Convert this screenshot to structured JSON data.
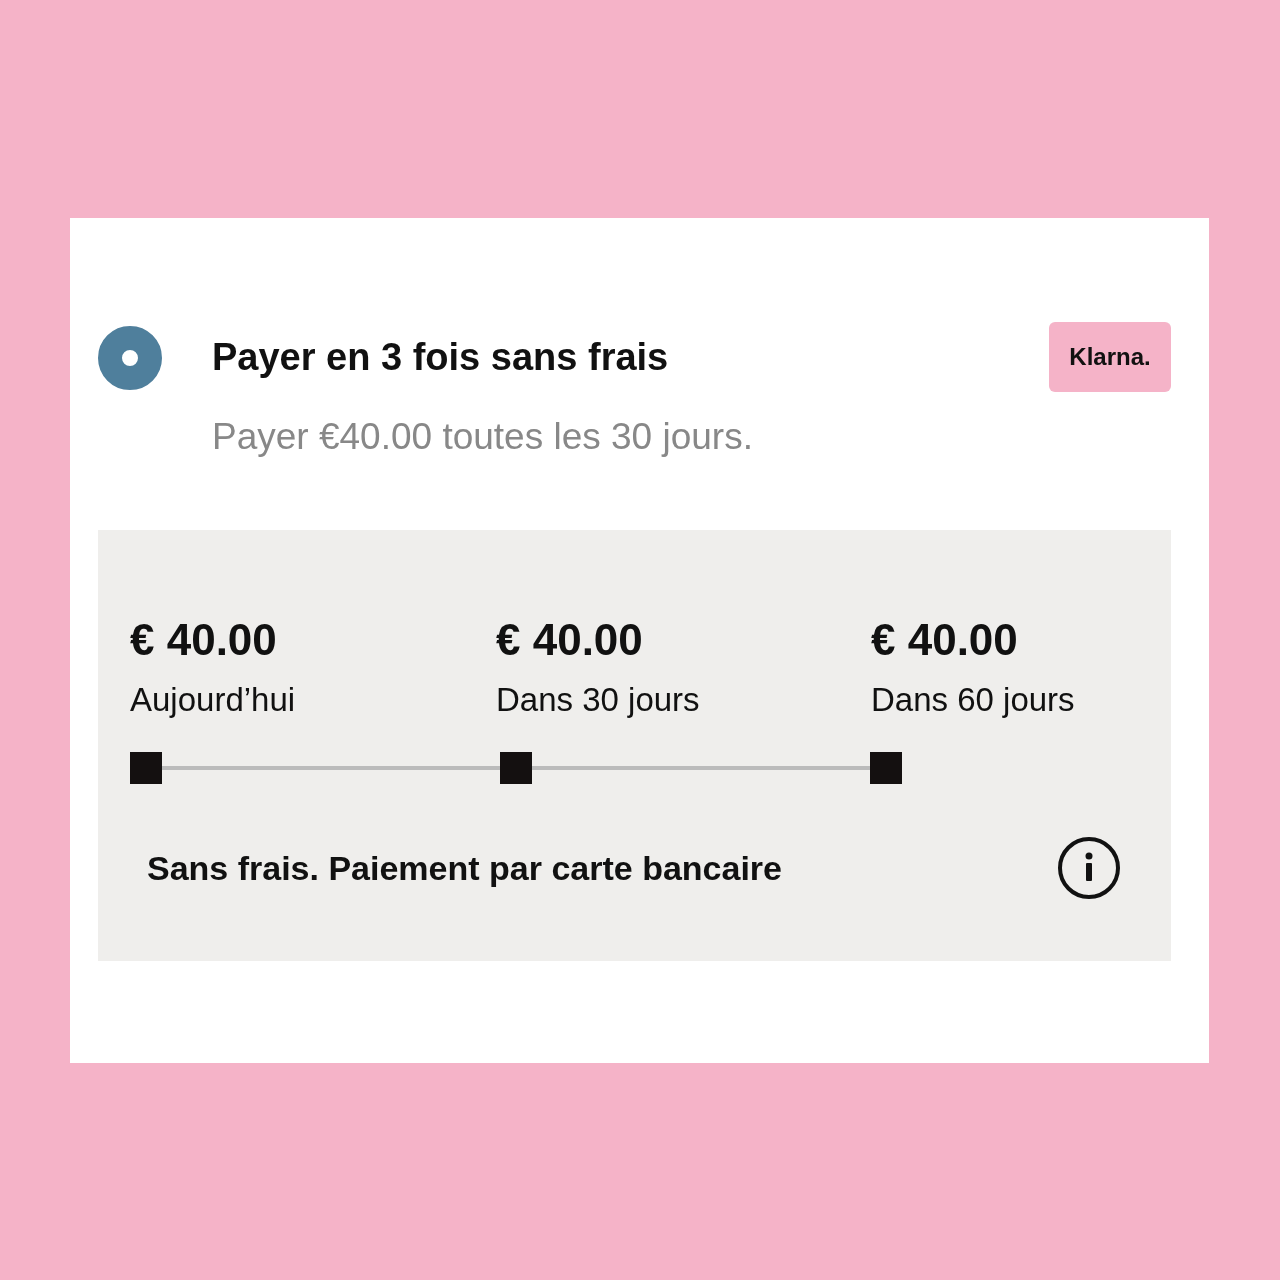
{
  "option": {
    "title": "Payer en 3 fois sans frais",
    "subtitle": "Payer €40.00 toutes les 30 jours.",
    "selected": true,
    "badge": "Klarna."
  },
  "schedule": {
    "installments": [
      {
        "amount": "€ 40.00",
        "label": "Aujourd’hui"
      },
      {
        "amount": "€ 40.00",
        "label": "Dans 30 jours"
      },
      {
        "amount": "€ 40.00",
        "label": "Dans 60 jours"
      }
    ],
    "note": "Sans frais. Paiement par carte bancaire"
  }
}
